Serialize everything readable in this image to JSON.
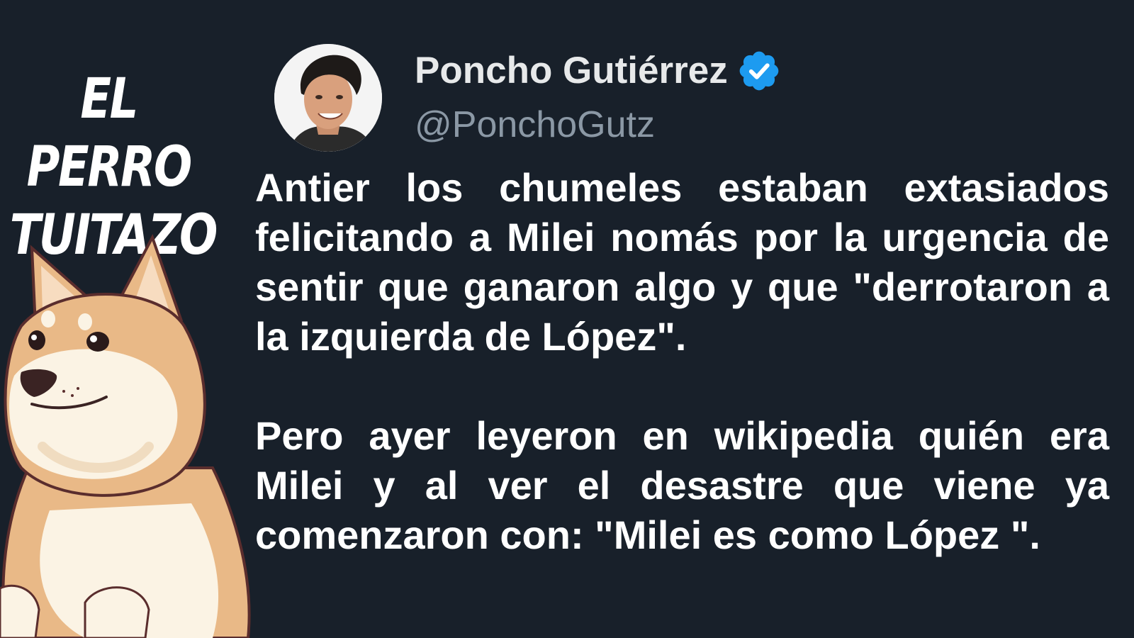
{
  "brand": {
    "line1": "EL PERRO",
    "line2": "TUITAZO"
  },
  "author": {
    "name": "Poncho Gutiérrez",
    "handle": "@PonchoGutz",
    "verified_badge_icon": "verified-check-icon",
    "verified_color": "#1d9bf0"
  },
  "tweet": {
    "paragraph1": "Antier los chumeles estaban extasiados felicitando a Milei nomás por la urgencia de sentir que ganaron algo y que \"derrotaron a la izquierda de López\".",
    "paragraph2": "Pero ayer leyeron en wikipedia quién era Milei y al ver el desastre que viene ya comenzaron con: \"Milei es como López \"."
  },
  "colors": {
    "background": "#18202a",
    "text": "#ffffff",
    "name": "#e7e9ea",
    "handle": "#8b98a5"
  }
}
